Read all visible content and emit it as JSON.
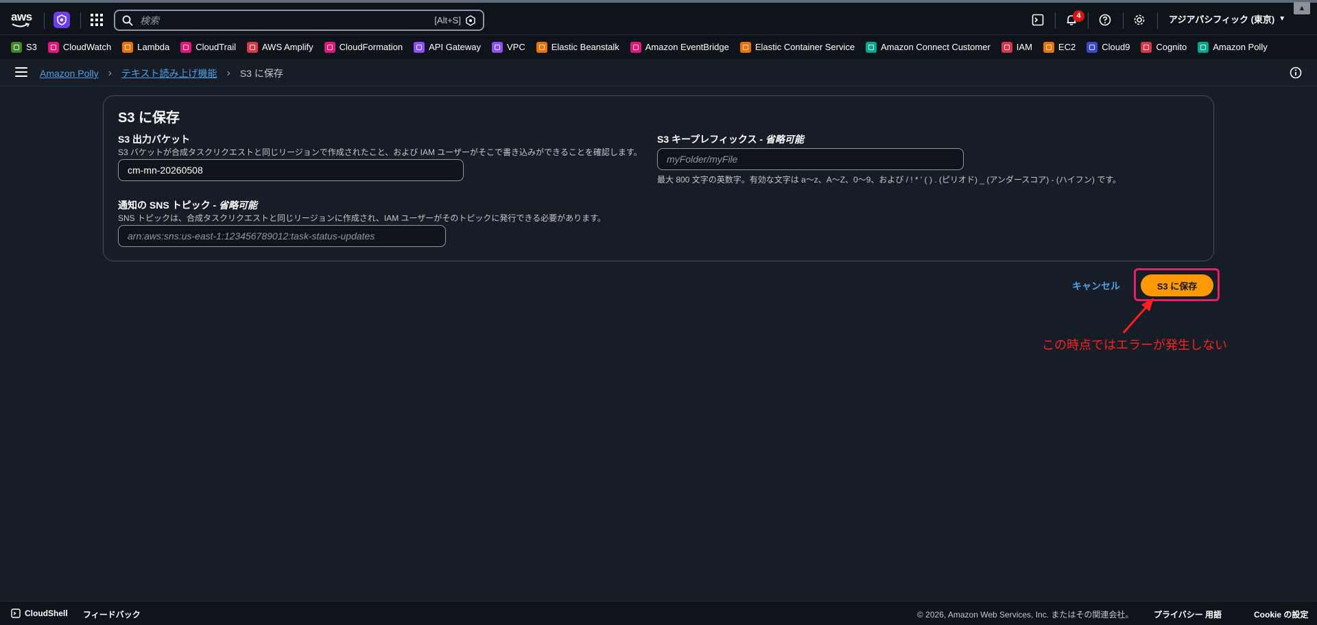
{
  "topnav": {
    "logo_text": "aws",
    "search_placeholder": "検索",
    "search_shortcut": "[Alt+S]",
    "notification_count": "4",
    "region": "アジアパシフィック (東京)"
  },
  "favorites": [
    {
      "label": "S3",
      "color": "#3f8624"
    },
    {
      "label": "CloudWatch",
      "color": "#e7157b"
    },
    {
      "label": "Lambda",
      "color": "#ed7100"
    },
    {
      "label": "CloudTrail",
      "color": "#e7157b"
    },
    {
      "label": "AWS Amplify",
      "color": "#dd344c"
    },
    {
      "label": "CloudFormation",
      "color": "#e7157b"
    },
    {
      "label": "API Gateway",
      "color": "#8c4fff"
    },
    {
      "label": "VPC",
      "color": "#8c4fff"
    },
    {
      "label": "Elastic Beanstalk",
      "color": "#ed7100"
    },
    {
      "label": "Amazon EventBridge",
      "color": "#e7157b"
    },
    {
      "label": "Elastic Container Service",
      "color": "#ed7100"
    },
    {
      "label": "Amazon Connect Customer",
      "color": "#01a88d"
    },
    {
      "label": "IAM",
      "color": "#dd344c"
    },
    {
      "label": "EC2",
      "color": "#ed7100"
    },
    {
      "label": "Cloud9",
      "color": "#3b48cc"
    },
    {
      "label": "Cognito",
      "color": "#dd344c"
    },
    {
      "label": "Amazon Polly",
      "color": "#01a88d"
    }
  ],
  "breadcrumb": {
    "item1": "Amazon Polly",
    "item2": "テキスト読み上げ機能",
    "current": "S3 に保存"
  },
  "form": {
    "title": "S3 に保存",
    "bucket_label": "S3 出力バケット",
    "bucket_desc": "S3 バケットが合成タスクリクエストと同じリージョンで作成されたこと、および IAM ユーザーがそこで書き込みができることを確認します。",
    "bucket_value": "cm-mn-20260508",
    "prefix_label": "S3 キープレフィックス - ",
    "prefix_optional": "省略可能",
    "prefix_placeholder": "myFolder/myFile",
    "prefix_hint": "最大 800 文字の英数字。有効な文字は a〜z、A〜Z、0〜9、および / ! * ' ( ) . (ピリオド) _ (アンダースコア) - (ハイフン) です。",
    "sns_label": "通知の SNS トピック - ",
    "sns_optional": "省略可能",
    "sns_desc": "SNS トピックは、合成タスクリクエストと同じリージョンに作成され、IAM ユーザーがそのトピックに発行できる必要があります。",
    "sns_placeholder": "arn:aws:sns:us-east-1:123456789012:task-status-updates"
  },
  "actions": {
    "cancel": "キャンセル",
    "save": "S3 に保存"
  },
  "annotation": {
    "text": "この時点ではエラーが発生しない",
    "color": "#ff2020"
  },
  "footer": {
    "cloudshell": "CloudShell",
    "feedback": "フィードバック",
    "copyright": "© 2026, Amazon Web Services, Inc. またはその関連会社。",
    "privacy": "プライバシー",
    "terms": "用語",
    "cookie": "Cookie の設定"
  }
}
